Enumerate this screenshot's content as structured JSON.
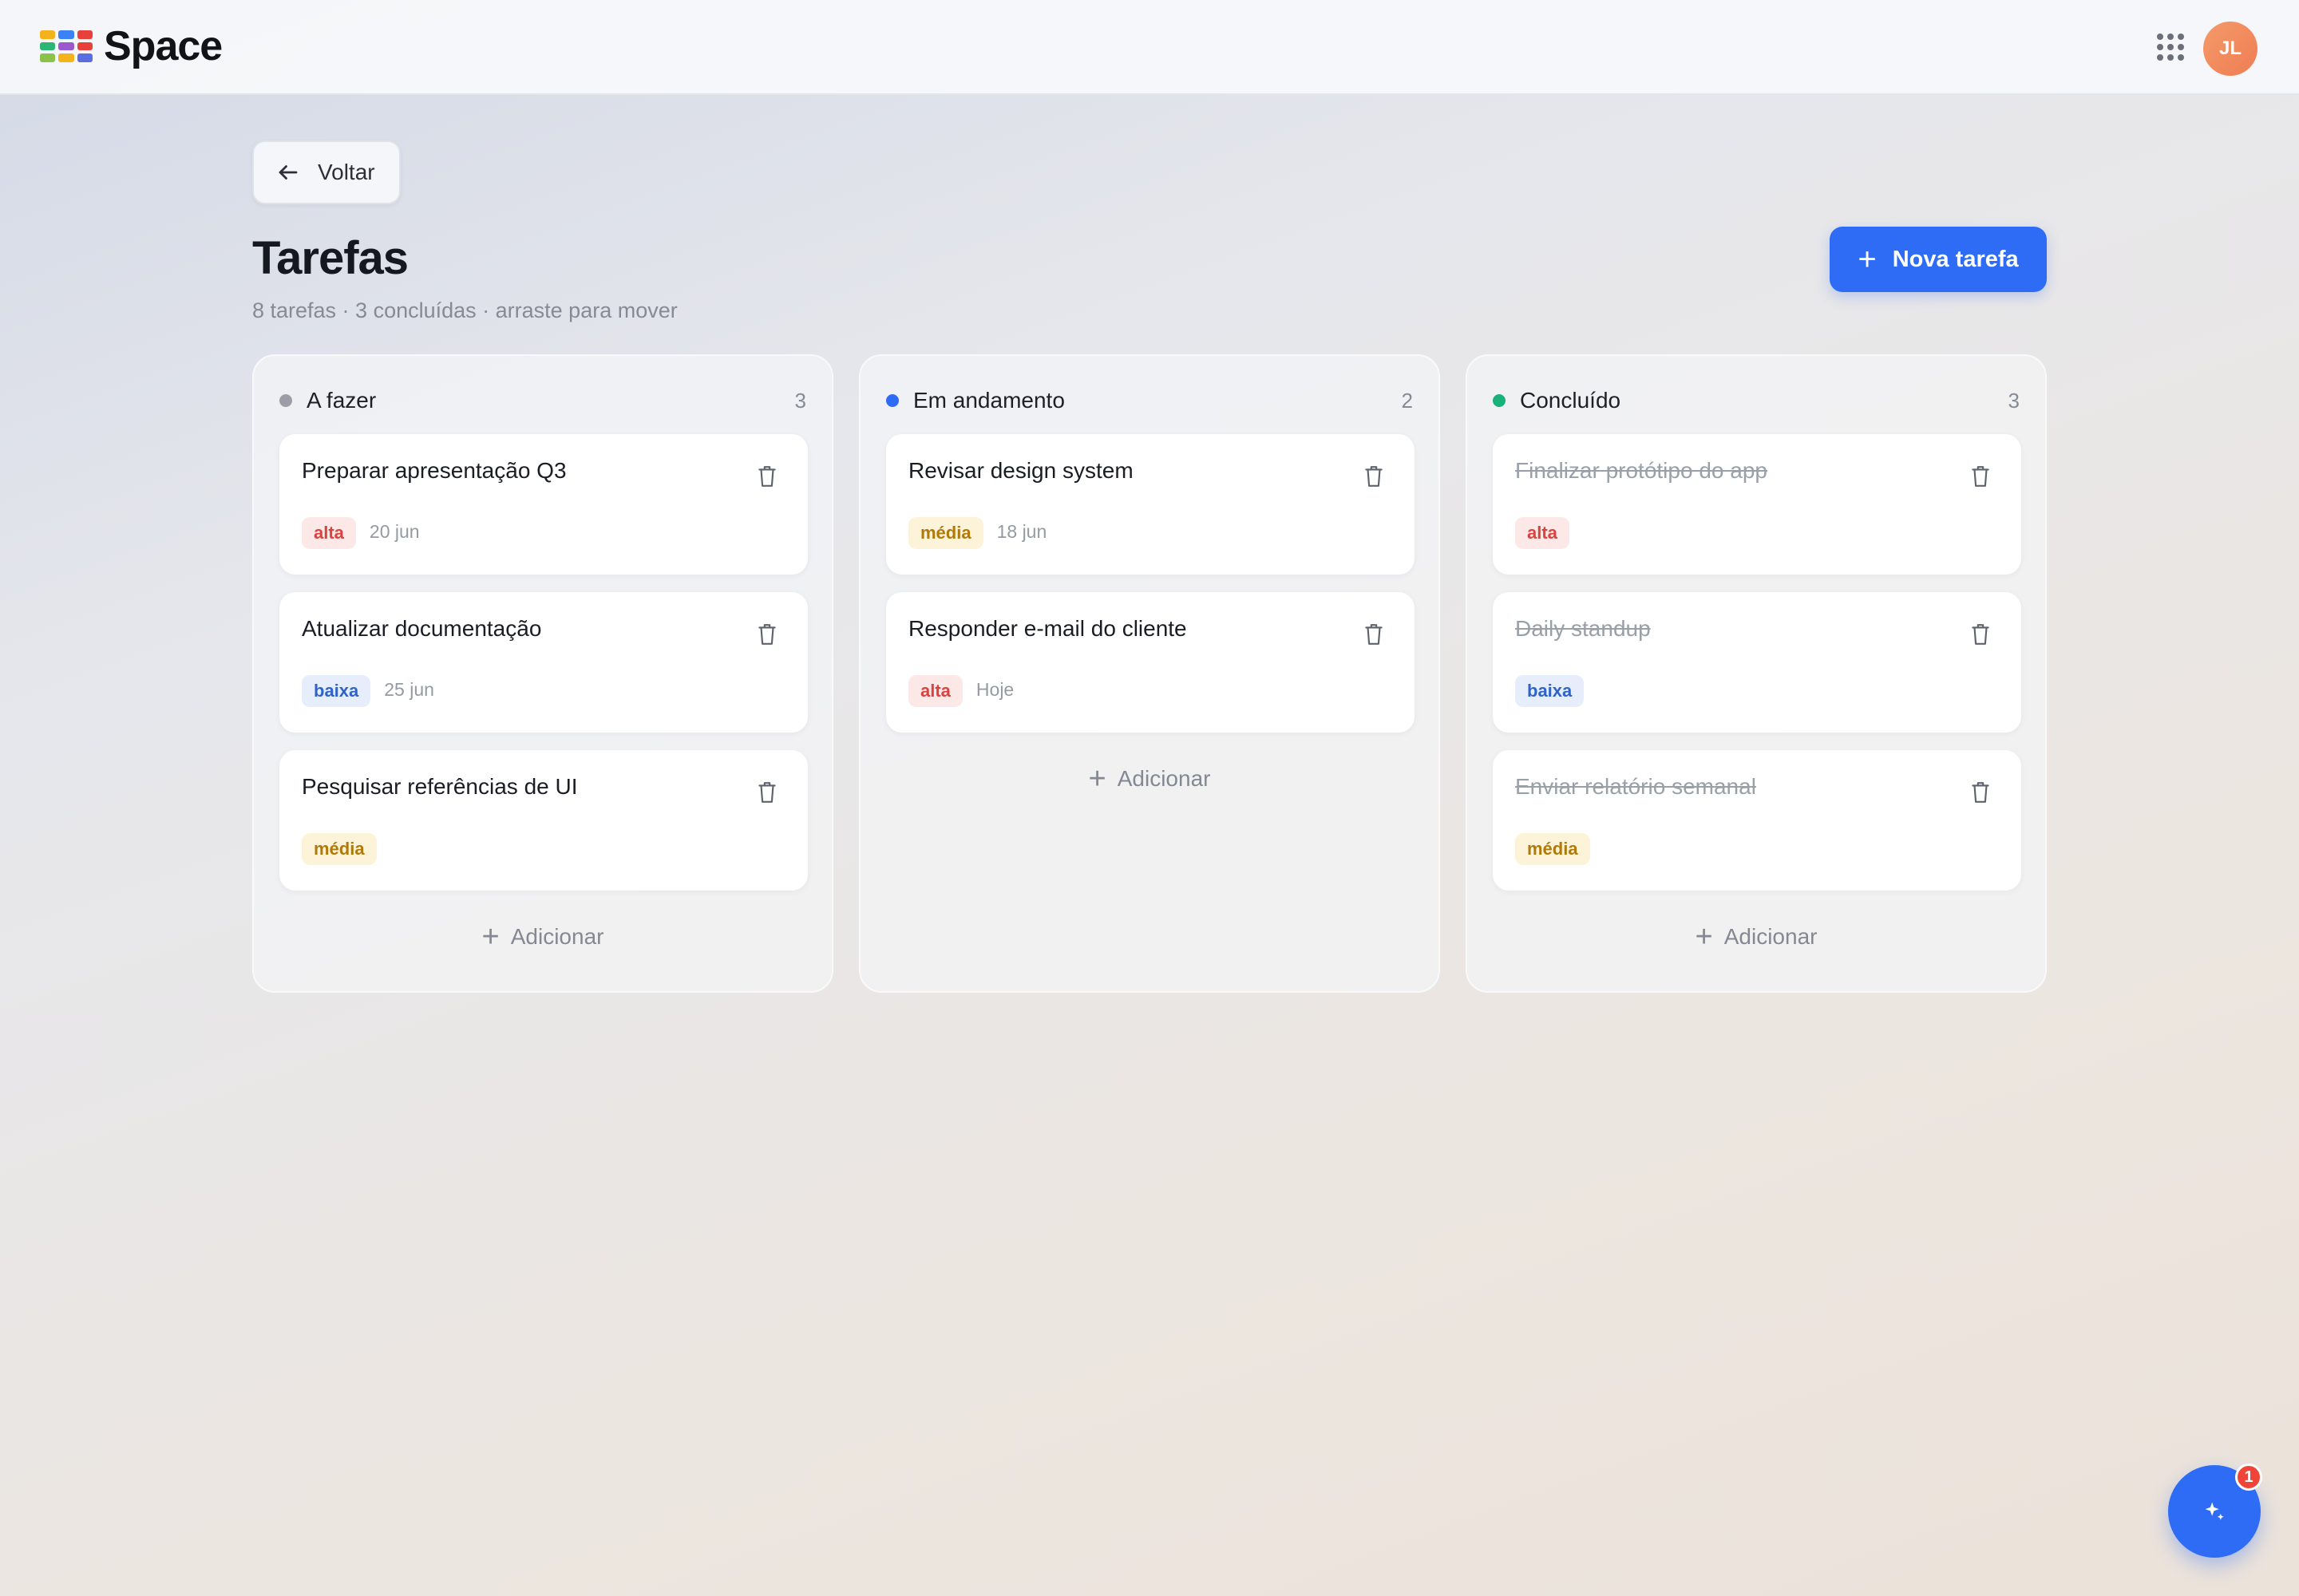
{
  "app": {
    "name": "Space",
    "user_initials": "JL",
    "logo_colors": [
      "#f4b31c",
      "#3b82f6",
      "#e8413c",
      "#2bb673",
      "#9b59d0",
      "#f4b31c",
      "#8bc34a",
      "#e8413c",
      "#5b6ee1"
    ]
  },
  "header": {
    "back_label": "Voltar",
    "title": "Tarefas",
    "subtitle": "8 tarefas · 3 concluídas · arraste para mover",
    "new_task_label": "Nova tarefa"
  },
  "columns": [
    {
      "title": "A fazer",
      "count": "3",
      "dot_color": "#9b9ea6",
      "add_label": "Adicionar",
      "cards": [
        {
          "title": "Preparar apresentação Q3",
          "priority": "alta",
          "due": "20 jun"
        },
        {
          "title": "Atualizar documentação",
          "priority": "baixa",
          "due": "25 jun"
        },
        {
          "title": "Pesquisar referências de UI",
          "priority": "média",
          "due": ""
        }
      ]
    },
    {
      "title": "Em andamento",
      "count": "2",
      "dot_color": "#2f6cf6",
      "add_label": "Adicionar",
      "cards": [
        {
          "title": "Revisar design system",
          "priority": "média",
          "due": "18 jun"
        },
        {
          "title": "Responder e-mail do cliente",
          "priority": "alta",
          "due": "Hoje"
        }
      ]
    },
    {
      "title": "Concluído",
      "count": "3",
      "dot_color": "#19b27a",
      "add_label": "Adicionar",
      "cards": [
        {
          "title": "Finalizar protótipo do app",
          "priority": "alta",
          "due": ""
        },
        {
          "title": "Daily standup",
          "priority": "baixa",
          "due": ""
        },
        {
          "title": "Enviar relatório semanal",
          "priority": "média",
          "due": ""
        }
      ]
    }
  ],
  "fab": {
    "icon": "sparkle-icon",
    "badge": "1"
  }
}
